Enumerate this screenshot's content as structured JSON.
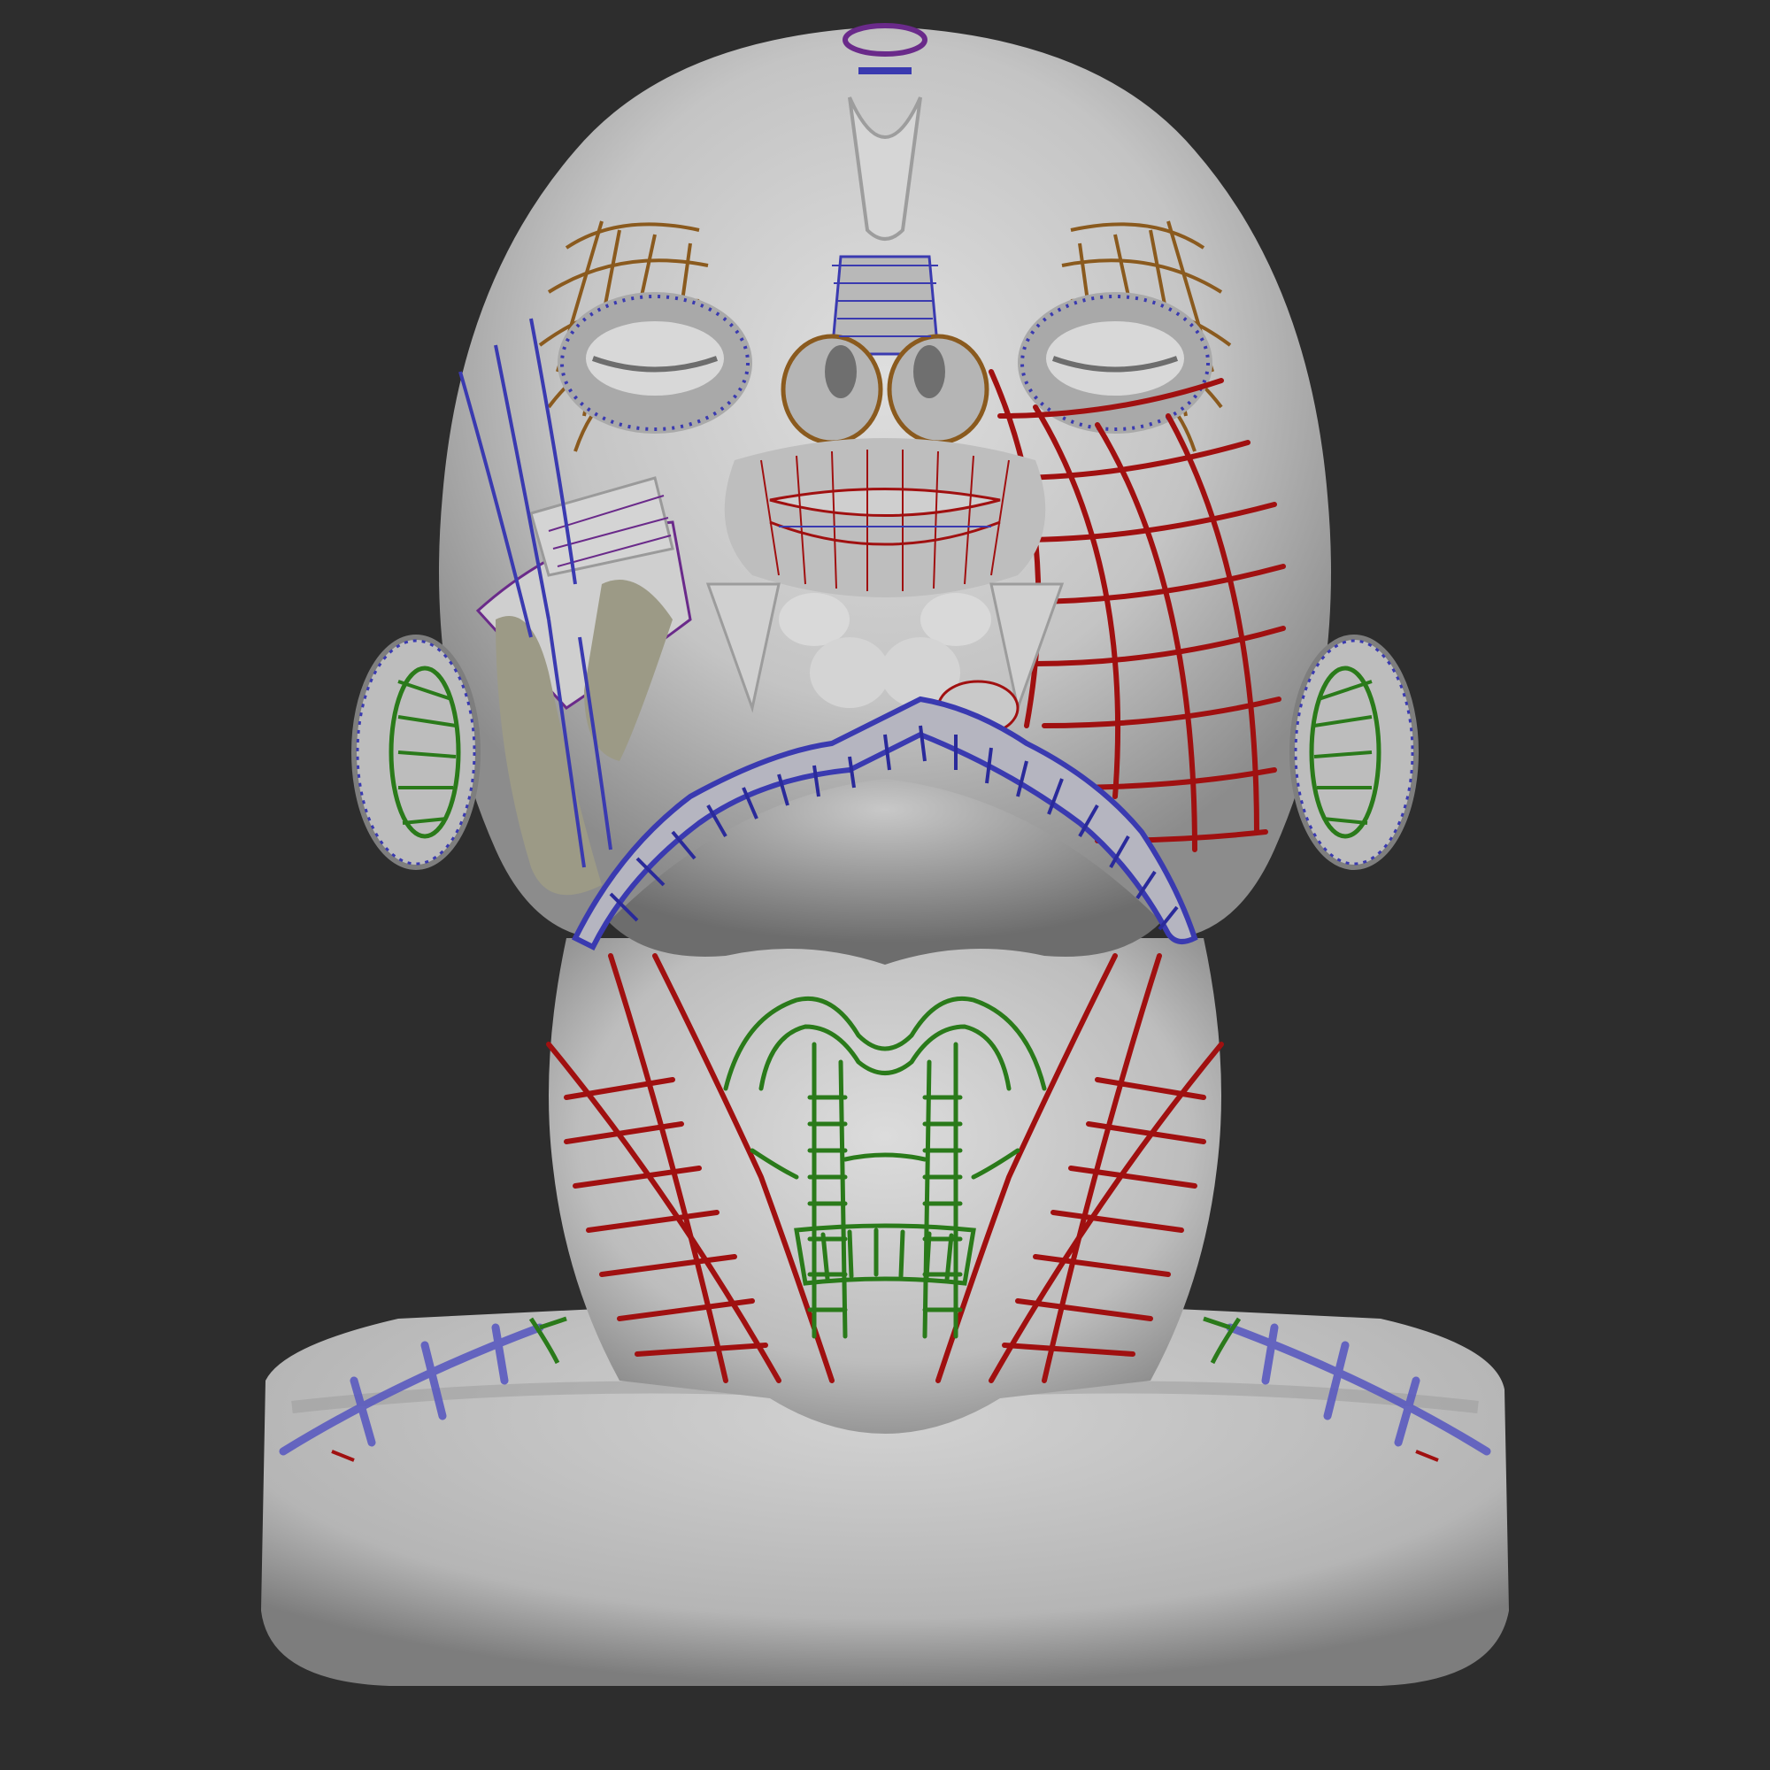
{
  "scene": {
    "background_color": "#2d2d2d",
    "model_base_color": "#c9c9c9",
    "model_shadow_color": "#8f8f8f",
    "bone_color": "#9c9a86",
    "flow_line_colors": {
      "red": "#a01010",
      "blue": "#3a3ab0",
      "green": "#2a7a1a",
      "brown": "#8a5a1e",
      "purple": "#6a2a8a"
    },
    "icons": {
      "head": "sculpted-head-icon",
      "ear": "ear-icon"
    }
  }
}
